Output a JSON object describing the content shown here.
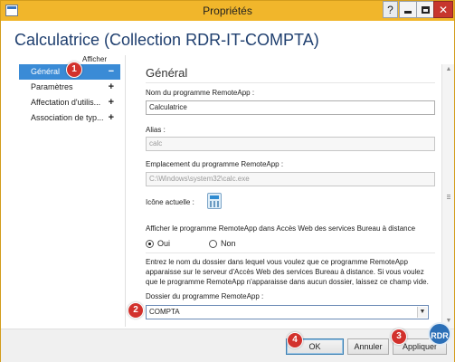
{
  "window": {
    "title": "Propriétés",
    "help_glyph": "?",
    "close_glyph": "✕",
    "heading": "Calculatrice (Collection RDR-IT-COMPTA)"
  },
  "sidebar": {
    "show_all": "Afficher tout",
    "items": [
      {
        "label": "Général",
        "sign": "−",
        "selected": true
      },
      {
        "label": "Paramètres",
        "sign": "+"
      },
      {
        "label": "Affectation d'utilis...",
        "sign": "+"
      },
      {
        "label": "Association de typ...",
        "sign": "+"
      }
    ]
  },
  "main": {
    "section_title": "Général",
    "program_name_label": "Nom du programme RemoteApp :",
    "program_name_value": "Calculatrice",
    "alias_label": "Alias :",
    "alias_value": "calc",
    "location_label": "Emplacement du programme RemoteApp :",
    "location_value": "C:\\Windows\\system32\\calc.exe",
    "icon_label": "Icône actuelle :",
    "show_in_web_label": "Afficher le programme RemoteApp dans Accès Web des services Bureau à distance",
    "radio_yes": "Oui",
    "radio_no": "Non",
    "radio_selected": "Oui",
    "description_line1": "Entrez le nom du dossier dans lequel vous voulez que ce programme RemoteApp",
    "description_line2": "apparaisse sur le serveur d'Accès Web des services Bureau à distance. Si vous voulez",
    "description_line3": "que le programme RemoteApp n'apparaisse dans aucun dossier, laissez ce champ vide.",
    "folder_label": "Dossier du programme RemoteApp :",
    "folder_value": "COMPTA"
  },
  "footer": {
    "ok_label": "OK",
    "cancel_label": "Annuler",
    "apply_label": "Appliquer"
  },
  "annotations": {
    "badge1": "1",
    "badge2": "2",
    "badge3": "3",
    "badge4": "4"
  },
  "watermark": "RDR",
  "colors": {
    "titlebar": "#f1b62b",
    "selection": "#3a8bd6",
    "badge": "#d2312c",
    "heading": "#1f3f6f",
    "close_button": "#c7362d"
  }
}
